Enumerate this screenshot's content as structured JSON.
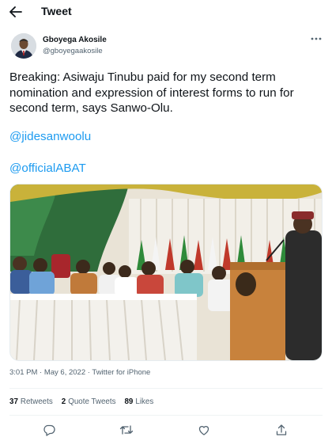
{
  "header": {
    "title": "Tweet",
    "back_icon": "arrow-left-icon"
  },
  "author": {
    "name": "Gboyega Akosile",
    "handle": "@gboyegaakosile",
    "more_icon": "more-options-icon"
  },
  "tweet": {
    "text": "Breaking: Asiwaju Tinubu paid for my second term nomination and expression of interest forms to run for second term, says Sanwo-Olu.",
    "mentions": [
      "@jidesanwoolu",
      "@officialABAT"
    ]
  },
  "media": {
    "alt": "photo"
  },
  "meta": {
    "time": "3:01 PM",
    "dot1": "·",
    "date": "May 6, 2022",
    "dot2": "·",
    "client": "Twitter for iPhone"
  },
  "stats": {
    "retweets_count": "37",
    "retweets_label": "Retweets",
    "quotes_count": "2",
    "quotes_label": "Quote Tweets",
    "likes_count": "89",
    "likes_label": "Likes"
  },
  "actions": [
    "reply-icon",
    "retweet-icon",
    "like-icon",
    "share-icon"
  ],
  "colors": {
    "link": "#1d9bf0",
    "text": "#0f1419",
    "muted": "#536471"
  }
}
